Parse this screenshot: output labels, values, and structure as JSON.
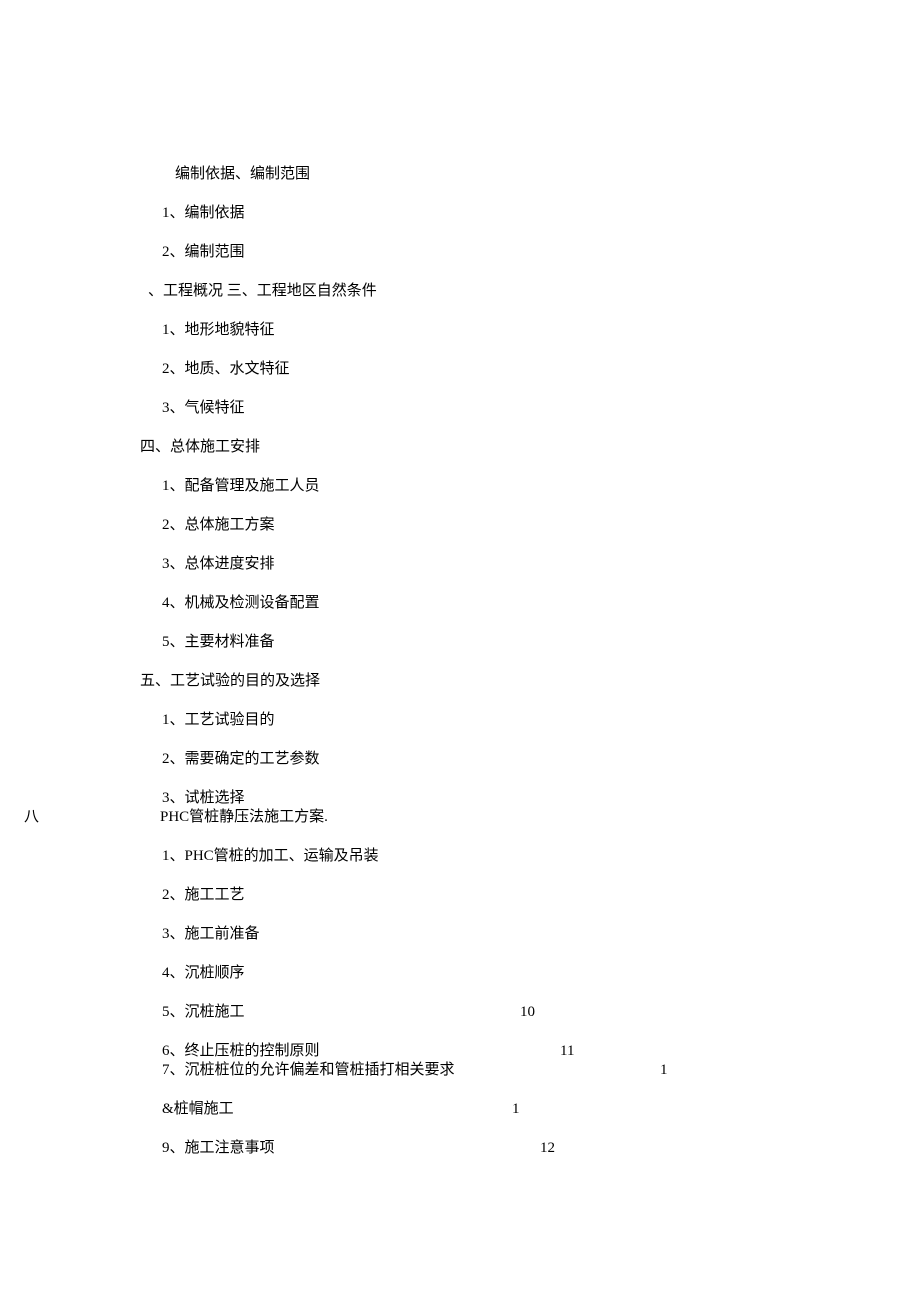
{
  "lines": [
    {
      "text": "编制依据、编制范围",
      "cls": "indent-3"
    },
    {
      "text": "1、编制依据",
      "cls": "indent-2"
    },
    {
      "text": "2、编制范围",
      "cls": "indent-2"
    },
    {
      "text": "、工程概况 三、工程地区自然条件",
      "cls": "indent-1b"
    },
    {
      "text": "1、地形地貌特征",
      "cls": "indent-2"
    },
    {
      "text": "2、地质、水文特征",
      "cls": "indent-2"
    },
    {
      "text": "3、气候特征",
      "cls": "indent-2"
    },
    {
      "text": "四、总体施工安排",
      "cls": "indent-1"
    },
    {
      "text": "1、配备管理及施工人员",
      "cls": "indent-2"
    },
    {
      "text": "2、总体施工方案",
      "cls": "indent-2"
    },
    {
      "text": "3、总体进度安排",
      "cls": "indent-2"
    },
    {
      "text": "4、机械及检测设备配置",
      "cls": "indent-2"
    },
    {
      "text": "5、主要材料准备",
      "cls": "indent-2"
    },
    {
      "text": "五、工艺试验的目的及选择",
      "cls": "indent-1"
    },
    {
      "text": "1、工艺试验目的",
      "cls": "indent-2"
    },
    {
      "text": "2、需要确定的工艺参数",
      "cls": "indent-2"
    },
    {
      "text": "3、试桩选择",
      "cls": "indent-2 tight"
    },
    {
      "text": " PHC管桩静压法施工方案.",
      "cls": "indent-2b",
      "prefix": "八"
    },
    {
      "text": "1、PHC管桩的加工、运输及吊装",
      "cls": "indent-2"
    },
    {
      "text": "2、施工工艺",
      "cls": "indent-2"
    },
    {
      "text": "3、施工前准备",
      "cls": "indent-2"
    },
    {
      "text": "4、沉桩顺序",
      "cls": "indent-2"
    },
    {
      "text": "5、沉桩施工",
      "cls": "indent-2",
      "page": "10",
      "pageCls": "pagenum-b"
    },
    {
      "text": "6、终止压桩的控制原则",
      "cls": "indent-2 tight",
      "page": "11",
      "pageCls": "pagenum-c"
    },
    {
      "text": "7、沉桩桩位的允许偏差和管桩插打相关要求",
      "cls": "indent-2",
      "page": "1",
      "pageCls": "pagenum-d"
    },
    {
      "text": "&桩帽施工",
      "cls": "indent-2",
      "page": "1",
      "pageCls": "pagenum-a"
    },
    {
      "text": "9、施工注意事项",
      "cls": "indent-2",
      "page": "12",
      "pageCls": "pagenum-e"
    }
  ]
}
